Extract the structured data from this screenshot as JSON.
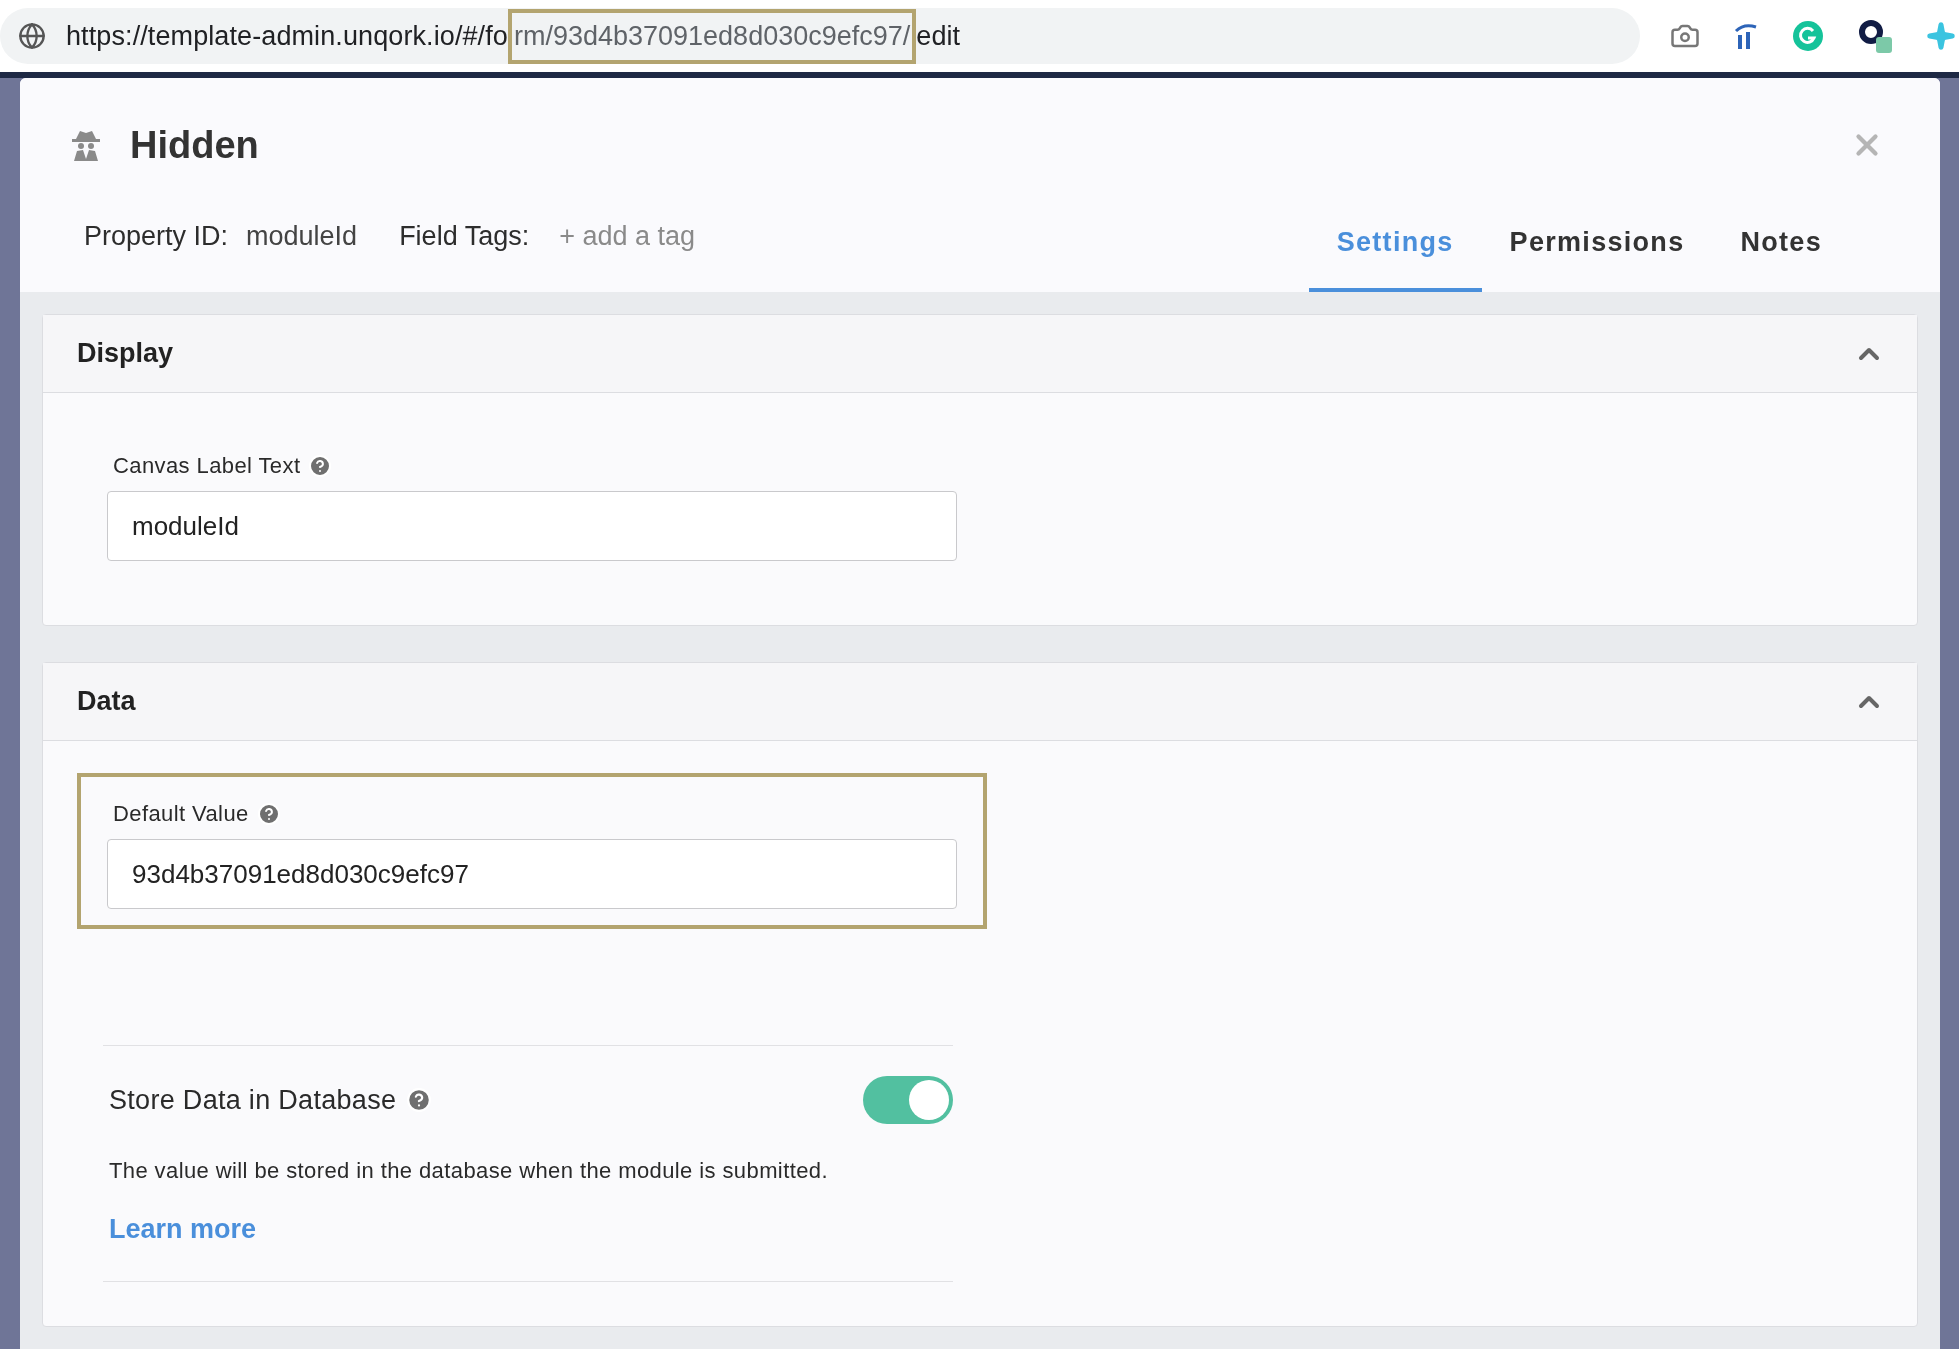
{
  "address_bar": {
    "url_start": "https://template-admin.unqork.io/#/fo",
    "url_marked": "rm/93d4b37091ed8d030c9efc97/",
    "url_end": "edit",
    "highlighted": true
  },
  "dialog": {
    "title": "Hidden",
    "property_id_label": "Property ID:",
    "property_id": "moduleId",
    "field_tags_label": "Field Tags:",
    "add_tag": "+ add a tag",
    "tabs": [
      {
        "label": "Settings",
        "selected": true
      },
      {
        "label": "Permissions",
        "selected": false
      },
      {
        "label": "Notes",
        "selected": false
      }
    ]
  },
  "panels": [
    {
      "title": "Display",
      "expanded": true,
      "fields": [
        {
          "kind": "text",
          "label": "Canvas Label Text",
          "value": "moduleId",
          "highlighted": false
        }
      ]
    },
    {
      "title": "Data",
      "expanded": true,
      "fields": [
        {
          "kind": "text",
          "label": "Default Value",
          "value": "93d4b37091ed8d030c9efc97",
          "highlighted": true
        },
        {
          "kind": "toggle",
          "label": "Store Data in Database",
          "on": true,
          "description": "The value will be stored in the database when the module is submitted.",
          "link": "Learn more"
        }
      ]
    }
  ]
}
